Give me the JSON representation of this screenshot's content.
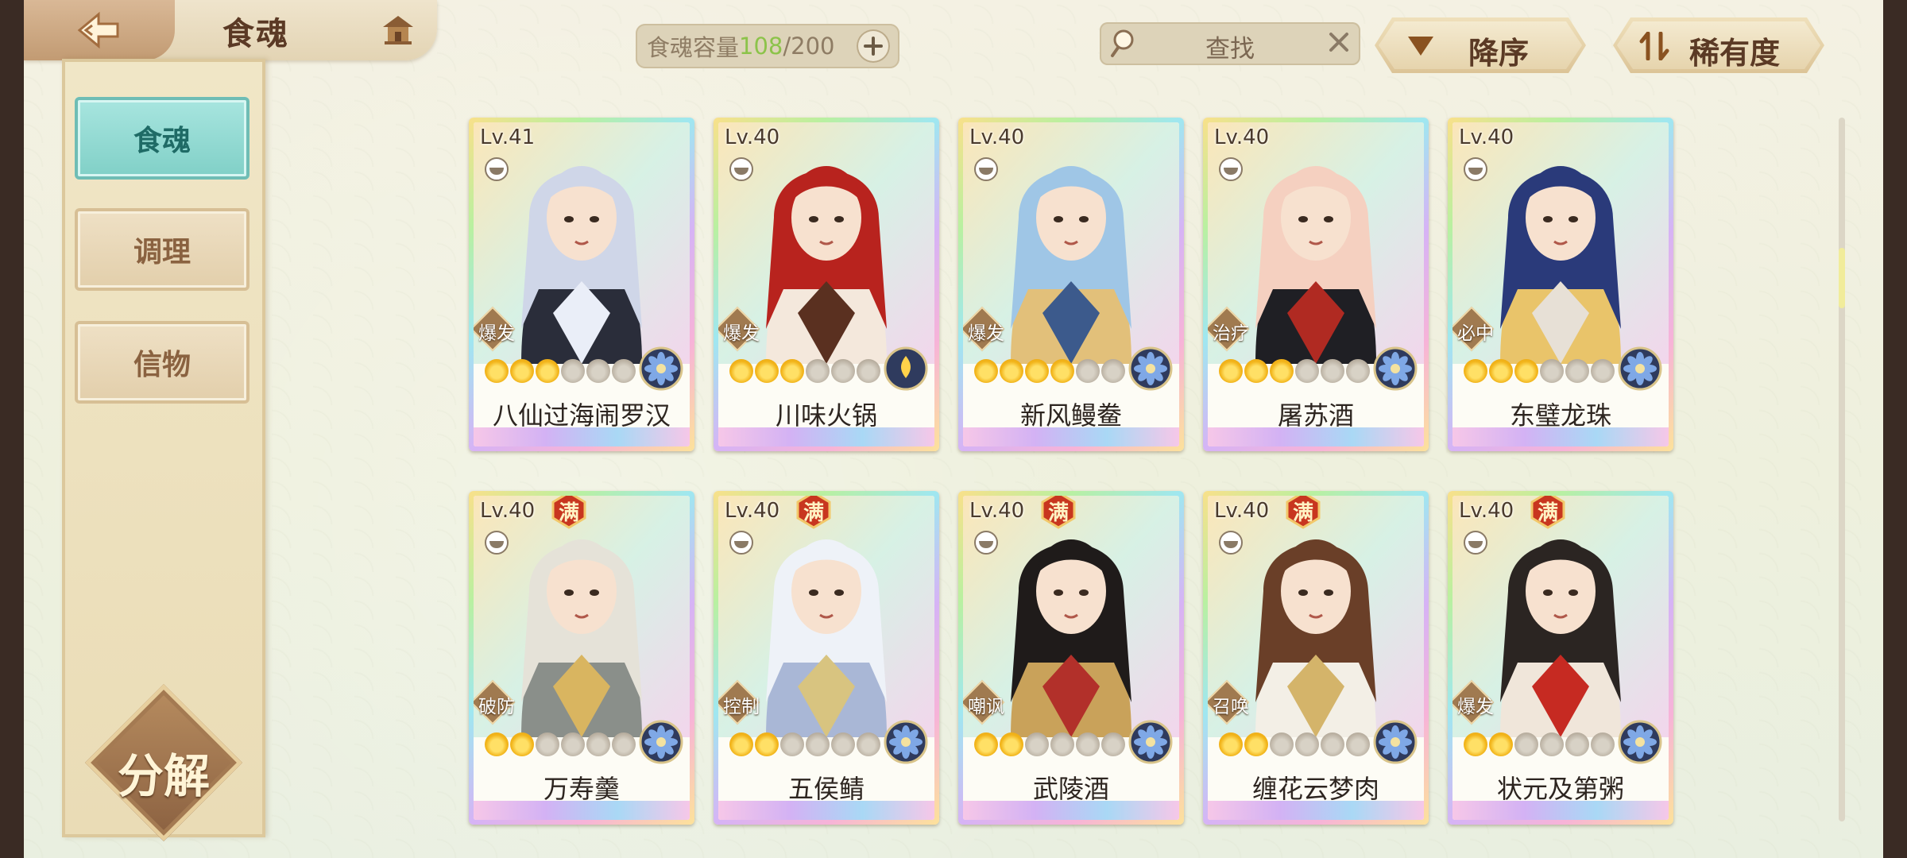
{
  "header": {
    "title": "食魂",
    "capacity_label": "食魂容量",
    "capacity_current": "108",
    "capacity_total": "/200",
    "search_label": "查找",
    "sort_order_label": "降序",
    "sort_key_label": "稀有度"
  },
  "sidebar": {
    "items": [
      {
        "label": "食魂",
        "active": true
      },
      {
        "label": "调理",
        "active": false
      },
      {
        "label": "信物",
        "active": false
      }
    ],
    "decompose_label": "分解"
  },
  "cards": [
    {
      "level": "Lv.41",
      "name": "八仙过海闹罗汉",
      "tag": "爆发",
      "stars": 6,
      "stars_filled": 3,
      "full": "",
      "element": "blue-flower",
      "palette": [
        "#cfd6e8",
        "#2a2d3a",
        "#eaeef8"
      ]
    },
    {
      "level": "Lv.40",
      "name": "川味火锅",
      "tag": "爆发",
      "stars": 6,
      "stars_filled": 3,
      "full": "",
      "element": "gold-flame",
      "palette": [
        "#b8231e",
        "#f4e8dc",
        "#5a3020"
      ]
    },
    {
      "level": "Lv.40",
      "name": "新风鳗鲞",
      "tag": "爆发",
      "stars": 6,
      "stars_filled": 4,
      "full": "",
      "element": "blue-flower",
      "palette": [
        "#9fc6e6",
        "#e2c07a",
        "#3c5a8c"
      ]
    },
    {
      "level": "Lv.40",
      "name": "屠苏酒",
      "tag": "治疗",
      "stars": 6,
      "stars_filled": 3,
      "full": "",
      "element": "blue-flower",
      "palette": [
        "#f5d0c0",
        "#1f1f24",
        "#b02a22"
      ]
    },
    {
      "level": "Lv.40",
      "name": "东璧龙珠",
      "tag": "必中",
      "stars": 6,
      "stars_filled": 3,
      "full": "",
      "element": "blue-flower",
      "palette": [
        "#2a3a7a",
        "#e9c46a",
        "#e7e0d6"
      ]
    },
    {
      "level": "Lv.40",
      "name": "万寿羹",
      "tag": "破防",
      "stars": 6,
      "stars_filled": 2,
      "full": "满",
      "element": "blue-flower",
      "palette": [
        "#e5e2d8",
        "#8a8f8a",
        "#d9b560"
      ]
    },
    {
      "level": "Lv.40",
      "name": "五侯鲭",
      "tag": "控制",
      "stars": 6,
      "stars_filled": 2,
      "full": "满",
      "element": "blue-flower",
      "palette": [
        "#eef2f8",
        "#a9b7d6",
        "#d8c480"
      ]
    },
    {
      "level": "Lv.40",
      "name": "武陵酒",
      "tag": "嘲讽",
      "stars": 6,
      "stars_filled": 2,
      "full": "满",
      "element": "blue-flower",
      "palette": [
        "#1f1b1a",
        "#c9a25a",
        "#b2302a"
      ]
    },
    {
      "level": "Lv.40",
      "name": "缠花云梦肉",
      "tag": "召唤",
      "stars": 6,
      "stars_filled": 2,
      "full": "满",
      "element": "blue-flower",
      "palette": [
        "#6a3f28",
        "#f3efe6",
        "#d4b46a"
      ]
    },
    {
      "level": "Lv.40",
      "name": "状元及第粥",
      "tag": "爆发",
      "stars": 6,
      "stars_filled": 2,
      "full": "满",
      "element": "blue-flower",
      "palette": [
        "#2b2522",
        "#f0e6da",
        "#c62a22"
      ]
    }
  ]
}
